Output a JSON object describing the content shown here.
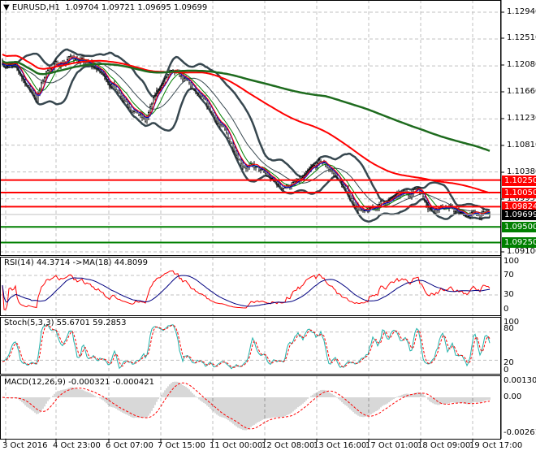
{
  "header": {
    "symbol": "EURUSD,H1",
    "open": "1.09704",
    "high": "1.09721",
    "low": "1.09695",
    "close": "1.09699"
  },
  "price_axis": [
    "1.12940",
    "1.12510",
    "1.12080",
    "1.11660",
    "1.11230",
    "1.10810",
    "1.10380",
    "1.09950",
    "1.09100"
  ],
  "levels": [
    {
      "price": 1.1025,
      "label": "1.10250",
      "color": "#ff0000"
    },
    {
      "price": 1.1005,
      "label": "1.10050",
      "color": "#ff0000"
    },
    {
      "price": 1.09824,
      "label": "1.09824",
      "color": "#ff0000"
    },
    {
      "price": 1.095,
      "label": "1.09500",
      "color": "#008000"
    },
    {
      "price": 1.0925,
      "label": "1.09250",
      "color": "#008000"
    }
  ],
  "current_price": {
    "price": 1.09699,
    "label": "1.09699",
    "color": "#000000"
  },
  "rsi": {
    "title": "RSI(14) 44.3714  ->MA(18) 44.8099",
    "ticks": [
      "100",
      "70",
      "30",
      "0"
    ]
  },
  "stoch": {
    "title": "Stoch(5,3,3) 55.6701 59.2853",
    "ticks": [
      "100",
      "80",
      "20",
      "0"
    ]
  },
  "macd": {
    "title": "MACD(12,26,9) -0.000321 -0.000421",
    "ticks": [
      "0.001301",
      "0.00",
      "-0.002614"
    ]
  },
  "time_axis": [
    "3 Oct 2016",
    "4 Oct 23:00",
    "6 Oct 07:00",
    "7 Oct 15:00",
    "11 Oct 00:00",
    "12 Oct 08:00",
    "13 Oct 16:00",
    "17 Oct 01:00",
    "18 Oct 09:00",
    "19 Oct 17:00"
  ],
  "chart_data": {
    "type": "line",
    "title": "EURUSD,H1",
    "bars": 301,
    "close_path": [
      [
        0,
        1.1216
      ],
      [
        8,
        1.1203
      ],
      [
        21,
        1.1157
      ],
      [
        28,
        1.1203
      ],
      [
        43,
        1.1222
      ],
      [
        58,
        1.1203
      ],
      [
        73,
        1.1164
      ],
      [
        88,
        1.1118
      ],
      [
        96,
        1.117
      ],
      [
        103,
        1.1196
      ],
      [
        113,
        1.1183
      ],
      [
        123,
        1.1151
      ],
      [
        133,
        1.1118
      ],
      [
        148,
        1.1053
      ],
      [
        158,
        1.104
      ],
      [
        171,
        1.1014
      ],
      [
        183,
        1.1021
      ],
      [
        196,
        1.1053
      ],
      [
        203,
        1.104
      ],
      [
        213,
        1.1001
      ],
      [
        223,
        1.0969
      ],
      [
        233,
        1.0988
      ],
      [
        248,
        1.1001
      ],
      [
        256,
        1.1014
      ],
      [
        263,
        1.0982
      ],
      [
        273,
        1.0982
      ],
      [
        283,
        1.0969
      ],
      [
        293,
        1.097
      ],
      [
        300,
        1.09699
      ]
    ],
    "ylim": [
      1.0905,
      1.13
    ],
    "indicators": [
      "SMA200",
      "SMA100",
      "SMA21",
      "SMA10",
      "SMA5",
      "Bollinger(20,2)",
      "RSI(14)",
      "MA(18) of RSI",
      "Stoch(5,3,3)",
      "MACD(12,26,9)"
    ]
  },
  "colors": {
    "bull_bear": "#000000",
    "ma_slow": "#1e6b1e",
    "ma_mid": "#ff0000",
    "bands": "#37474f",
    "rsi": "#ff0000",
    "rsi_ma": "#000080",
    "stoch_k": "#20b2aa",
    "stoch_d": "#ff0000",
    "macd_hist": "#b0b0b0"
  }
}
